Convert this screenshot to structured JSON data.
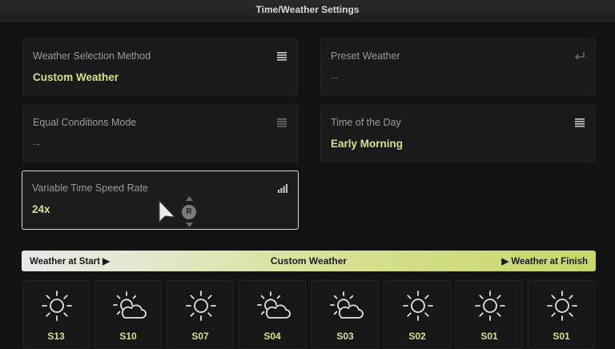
{
  "window": {
    "title": "Time/Weather Settings"
  },
  "settings": {
    "weather_selection_method": {
      "label": "Weather Selection Method",
      "value": "Custom Weather",
      "icon": "list-icon"
    },
    "preset_weather": {
      "label": "Preset Weather",
      "value": "--",
      "icon": "enter-icon"
    },
    "equal_conditions_mode": {
      "label": "Equal Conditions Mode",
      "value": "--",
      "icon": "list-icon"
    },
    "time_of_the_day": {
      "label": "Time of the Day",
      "value": "Early Morning",
      "icon": "list-icon"
    },
    "variable_time_speed_rate": {
      "label": "Variable Time Speed Rate",
      "value": "24x",
      "icon": "signal-bars-icon"
    }
  },
  "weather_rail": {
    "start_label": "Weather at Start ▶",
    "center_label": "Custom Weather",
    "finish_label": "▶ Weather at Finish"
  },
  "weather_slots": [
    {
      "label": "S13",
      "icon": "sun-icon"
    },
    {
      "label": "S10",
      "icon": "sun-cloud-icon"
    },
    {
      "label": "S07",
      "icon": "sun-icon"
    },
    {
      "label": "S04",
      "icon": "sun-cloud-icon"
    },
    {
      "label": "S03",
      "icon": "sun-cloud-icon"
    },
    {
      "label": "S02",
      "icon": "sun-icon"
    },
    {
      "label": "S01",
      "icon": "sun-icon"
    },
    {
      "label": "S01",
      "icon": "sun-icon"
    }
  ],
  "controller": {
    "badge": "R"
  },
  "colors": {
    "accent": "#d6e08a",
    "background": "#131313"
  }
}
